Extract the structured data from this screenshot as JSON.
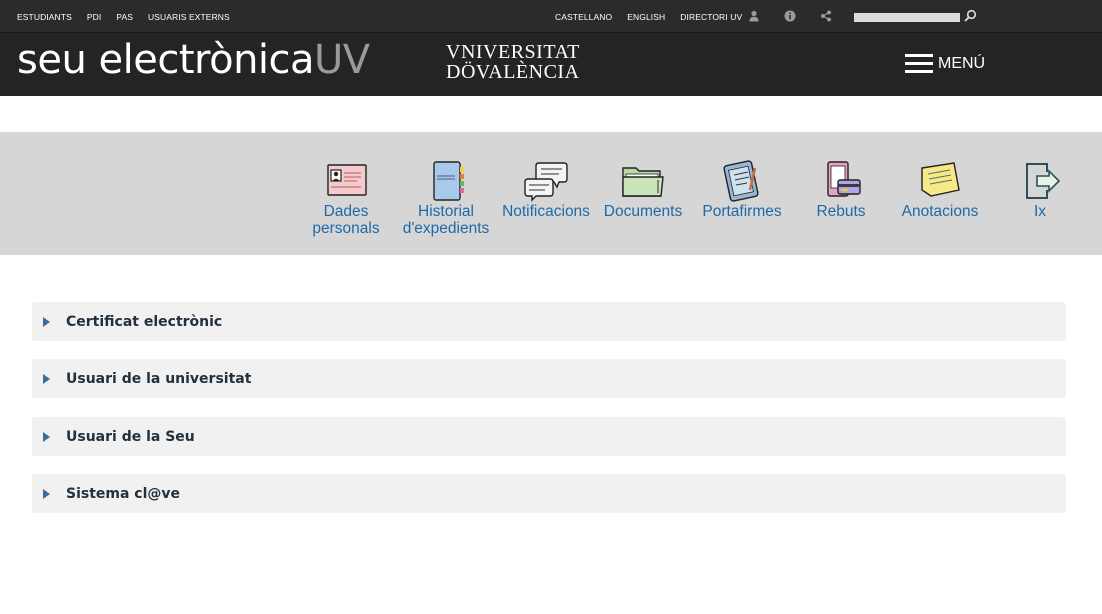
{
  "topbar": {
    "left_links": [
      "ESTUDIANTS",
      "PDI",
      "PAS",
      "USUARIS EXTERNS"
    ],
    "right_links": [
      "CASTELLANO",
      "ENGLISH",
      "DIRECTORI UV"
    ],
    "icons": [
      "user-icon",
      "info-icon",
      "share-icon"
    ],
    "search": {
      "value": "",
      "placeholder": ""
    }
  },
  "brand": {
    "logo_main": "seu electrònica",
    "logo_suffix": "UV",
    "university_line1": "VNIVERSITAT",
    "university_line2": "DÖVALÈNCIA",
    "menu_label": "MENÚ"
  },
  "apps": [
    {
      "label": "Dades personals",
      "icon": "id-card-icon"
    },
    {
      "label": "Historial d'expedients",
      "icon": "notebook-icon"
    },
    {
      "label": "Notificacions",
      "icon": "chat-bubbles-icon"
    },
    {
      "label": "Documents",
      "icon": "folder-icon"
    },
    {
      "label": "Portafirmes",
      "icon": "tablet-pen-icon"
    },
    {
      "label": "Rebuts",
      "icon": "receipt-card-icon"
    },
    {
      "label": "Anotacions",
      "icon": "sticky-note-icon"
    },
    {
      "label": "Ix",
      "icon": "logout-icon"
    }
  ],
  "accordion": [
    {
      "title": "Certificat electrònic"
    },
    {
      "title": "Usuari de la universitat"
    },
    {
      "title": "Usuari de la Seu"
    },
    {
      "title": "Sistema cl@ve"
    }
  ],
  "colors": {
    "topbar": "#2b2b2b",
    "brandbar": "#242424",
    "strip": "#d6d6d6",
    "link": "#1e6aa8",
    "accordion_bg": "#f1f1f1",
    "accordion_arrow": "#3a6e9b"
  }
}
